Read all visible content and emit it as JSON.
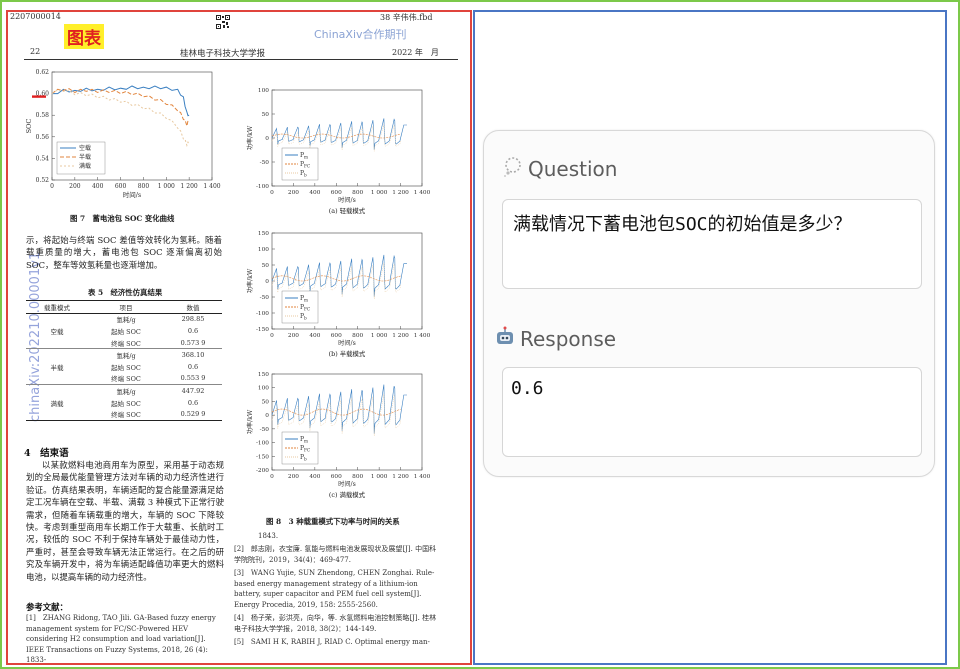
{
  "header": {
    "doc_number": "2207000014",
    "file_name": "38 辛伟伟.fbd",
    "page_number": "22",
    "journal": "桂林电子科技大学学报",
    "issue": "2022 年　月",
    "watermark_top": "ChinaXiv合作期刊",
    "watermark_side": "chinaXiv:202210.00001v1",
    "figure_tag": "图表"
  },
  "fig7": {
    "caption": "图 7　蓄电池包 SOC 变化曲线",
    "ylabel": "SOC",
    "xlabel": "时间/s",
    "ytick_labels": [
      "0.62",
      "0.60",
      "0.58",
      "0.56",
      "0.54",
      "0.52"
    ],
    "xtick_labels": [
      "0",
      "200",
      "400",
      "600",
      "800",
      "1 000",
      "1 200",
      "1 400"
    ],
    "legend": [
      "空载",
      "半载",
      "满载"
    ]
  },
  "chart_data": [
    {
      "type": "line",
      "title": "图 7　蓄电池包 SOC 变化曲线",
      "xlabel": "时间/s",
      "ylabel": "SOC",
      "xlim": [
        0,
        1400
      ],
      "ylim": [
        0.52,
        0.62
      ],
      "legend": "top-left",
      "colors": [
        "#3a7fc1",
        "#e2863f",
        "#e8c9a0"
      ],
      "series": [
        {
          "name": "空载",
          "x": [
            0,
            100,
            200,
            300,
            400,
            500,
            600,
            700,
            800,
            900,
            1000,
            1100,
            1150,
            1180,
            1200
          ],
          "y": [
            0.6,
            0.604,
            0.603,
            0.605,
            0.604,
            0.606,
            0.605,
            0.607,
            0.606,
            0.607,
            0.606,
            0.604,
            0.597,
            0.583,
            0.58
          ]
        },
        {
          "name": "半载",
          "x": [
            0,
            100,
            200,
            300,
            400,
            500,
            600,
            700,
            800,
            900,
            1000,
            1100,
            1150,
            1180,
            1200
          ],
          "y": [
            0.6,
            0.603,
            0.601,
            0.602,
            0.601,
            0.601,
            0.6,
            0.599,
            0.597,
            0.594,
            0.59,
            0.584,
            0.576,
            0.57,
            0.575
          ]
        },
        {
          "name": "满载",
          "x": [
            0,
            100,
            200,
            300,
            400,
            500,
            600,
            700,
            800,
            900,
            1000,
            1100,
            1150,
            1180,
            1200
          ],
          "y": [
            0.6,
            0.602,
            0.599,
            0.598,
            0.596,
            0.594,
            0.592,
            0.589,
            0.586,
            0.582,
            0.577,
            0.568,
            0.558,
            0.552,
            0.553
          ]
        }
      ]
    },
    {
      "type": "line",
      "title": "(a) 轻载模式",
      "xlabel": "时间/s",
      "ylabel": "功率/kW",
      "xlim": [
        0,
        1400
      ],
      "ylim": [
        -100,
        100
      ],
      "series_names": [
        "P_m",
        "P_FC",
        "P_b"
      ]
    },
    {
      "type": "line",
      "title": "(b) 半载模式",
      "xlabel": "时间/s",
      "ylabel": "功率/kW",
      "xlim": [
        0,
        1400
      ],
      "ylim": [
        -150,
        150
      ],
      "series_names": [
        "P_m",
        "P_FC",
        "P_b"
      ]
    },
    {
      "type": "line",
      "title": "(c) 满载模式",
      "xlabel": "时间/s",
      "ylabel": "功率/kW",
      "xlim": [
        0,
        1400
      ],
      "ylim": [
        -200,
        150
      ],
      "series_names": [
        "P_m",
        "P_FC",
        "P_b"
      ]
    }
  ],
  "fig8": {
    "caption": "图 8　3 种载重模式下功率与时间的关系",
    "ylabel": "功率/kW",
    "xlabel": "时间/s",
    "subplots": [
      {
        "label": "(a) 轻载模式",
        "yticks": [
          "100",
          "50",
          "0",
          "-50",
          "-100"
        ]
      },
      {
        "label": "(b) 半载模式",
        "yticks": [
          "150",
          "100",
          "50",
          "0",
          "-50",
          "-100",
          "-150"
        ]
      },
      {
        "label": "(c) 满载模式",
        "yticks": [
          "150",
          "100",
          "50",
          "0",
          "-50",
          "-100",
          "-150",
          "-200"
        ]
      }
    ],
    "xticks": [
      "0",
      "200",
      "400",
      "600",
      "800",
      "1 000",
      "1 200",
      "1 400"
    ],
    "legend": [
      "P",
      "P",
      "P"
    ],
    "legend_subs": [
      "m",
      "FC",
      "b"
    ]
  },
  "text": {
    "para1": "示，将起始与终端 SOC 差值等效转化为氢耗。随着载重质量的增大，蓄电池包 SOC 逐渐偏离初始 SOC，整车等效氢耗量也逐渐增加。",
    "table_title": "表 5　经济性仿真结果",
    "table_headers": [
      "载重模式",
      "项目",
      "数值"
    ],
    "table_rows": [
      {
        "mode": "空载",
        "items": [
          [
            "氢耗/g",
            "298.85"
          ],
          [
            "起始 SOC",
            "0.6"
          ],
          [
            "终端 SOC",
            "0.573 9"
          ]
        ]
      },
      {
        "mode": "半载",
        "items": [
          [
            "氢耗/g",
            "368.10"
          ],
          [
            "起始 SOC",
            "0.6"
          ],
          [
            "终端 SOC",
            "0.553 9"
          ]
        ]
      },
      {
        "mode": "满载",
        "items": [
          [
            "氢耗/g",
            "447.92"
          ],
          [
            "起始 SOC",
            "0.6"
          ],
          [
            "终端 SOC",
            "0.529 9"
          ]
        ]
      }
    ],
    "section_title": "4　结束语",
    "conclusion": "以某款燃料电池商用车为原型，采用基于动态规划的全局最优能量管理方法对车辆的动力经济性进行验证。仿真结果表明，车辆适配的复合能量源满足给定工况车辆在空载、半载、满载 3 种模式下正常行驶需求，但随着车辆载重的增大，车辆的 SOC 下降较快。考虑到重型商用车长期工作于大载重、长航时工况，较低的 SOC 不利于保持车辆处于最佳动力性，严重时，甚至会导致车辆无法正常运行。在之后的研究及车辆开发中，将为车辆适配峰值功率更大的燃料电池，以提高车辆的动力经济性。",
    "refs_title": "参考文献：",
    "ref1": "[1]　ZHANG Ridong, TAO Jili. GA-Based fuzzy energy management system for FC/SC-Powered HEV considering H2 consumption and load variation[J]. IEEE Transactions on Fuzzy Systems, 2018, 26 (4): 1833-",
    "ref_cont": "1843.",
    "ref2": "[2]　郎志刚，衣宝廉. 氢能与燃料电池发展现状及展望[J]. 中国科学院院刊，2019，34(4)：469-477.",
    "ref3": "[3]　WANG Yujie, SUN Zhendong, CHEN Zonghai. Rule-based energy management strategy of a lithium-ion battery, super capacitor and PEM fuel cell system[J]. Energy Procedia, 2019, 158: 2555-2560.",
    "ref4": "[4]　杨子荣，彭洪亮，向华，等. 水氢燃料电池控制策略[J]. 桂林电子科技大学学报，2018, 38(2)：144-149.",
    "ref5": "[5]　SAMI H K, RABIH J, RIAD C. Optimal energy man-"
  },
  "qa": {
    "question_label": "Question",
    "question": "满载情况下蓄电池包SOC的初始值是多少？",
    "response_label": "Response",
    "response": "0.6"
  }
}
